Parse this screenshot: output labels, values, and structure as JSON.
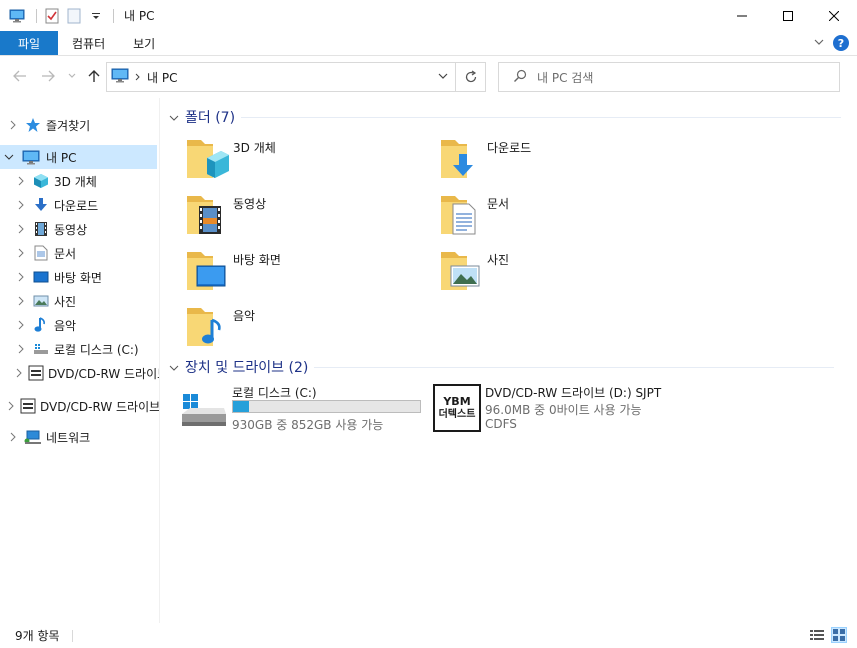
{
  "window": {
    "title": "내 PC"
  },
  "ribbon": {
    "tabs": [
      {
        "label": "파일",
        "active": true
      },
      {
        "label": "컴퓨터",
        "active": false
      },
      {
        "label": "보기",
        "active": false
      }
    ],
    "help_label": "?"
  },
  "address": {
    "path": "내 PC",
    "search_placeholder": "내 PC 검색"
  },
  "nav": {
    "items": [
      {
        "label": "즐겨찾기",
        "icon": "star-icon"
      },
      {
        "label": "내 PC",
        "icon": "pc-icon",
        "selected": true
      },
      {
        "label": "3D 개체",
        "icon": "3d-objects-icon"
      },
      {
        "label": "다운로드",
        "icon": "download-icon"
      },
      {
        "label": "동영상",
        "icon": "video-icon"
      },
      {
        "label": "문서",
        "icon": "document-icon"
      },
      {
        "label": "바탕 화면",
        "icon": "desktop-icon"
      },
      {
        "label": "사진",
        "icon": "picture-icon"
      },
      {
        "label": "음악",
        "icon": "music-icon"
      },
      {
        "label": "로컬 디스크 (C:)",
        "icon": "local-disk-icon"
      },
      {
        "label": "DVD/CD-RW 드라이브",
        "icon": "dvd-drive-icon"
      },
      {
        "label": "DVD/CD-RW 드라이브",
        "icon": "dvd-drive-icon"
      },
      {
        "label": "네트워크",
        "icon": "network-icon"
      }
    ]
  },
  "content": {
    "folders_header": "폴더 (7)",
    "folders": [
      {
        "label": "3D 개체",
        "icon": "3d-objects-folder-icon"
      },
      {
        "label": "다운로드",
        "icon": "downloads-folder-icon"
      },
      {
        "label": "동영상",
        "icon": "videos-folder-icon"
      },
      {
        "label": "문서",
        "icon": "documents-folder-icon"
      },
      {
        "label": "바탕 화면",
        "icon": "desktop-folder-icon"
      },
      {
        "label": "사진",
        "icon": "pictures-folder-icon"
      },
      {
        "label": "음악",
        "icon": "music-folder-icon"
      }
    ],
    "drives_header": "장치 및 드라이브 (2)",
    "drives": [
      {
        "name": "로컬 디스크 (C:)",
        "free": "930GB 중 852GB 사용 가능",
        "used_fraction": 0.0839
      },
      {
        "name": "DVD/CD-RW 드라이브 (D:) SJPT",
        "free": "96.0MB 중 0바이트 사용 가능",
        "fs": "CDFS",
        "logo_line1": "YBM",
        "logo_line2": "더텍스트"
      }
    ]
  },
  "status": {
    "item_count": "9개 항목"
  },
  "colors": {
    "accent": "#1979ca",
    "selection": "#cce8ff",
    "group_header": "#1e3287",
    "progress": "#26a0da",
    "folder": "#f8d775"
  }
}
